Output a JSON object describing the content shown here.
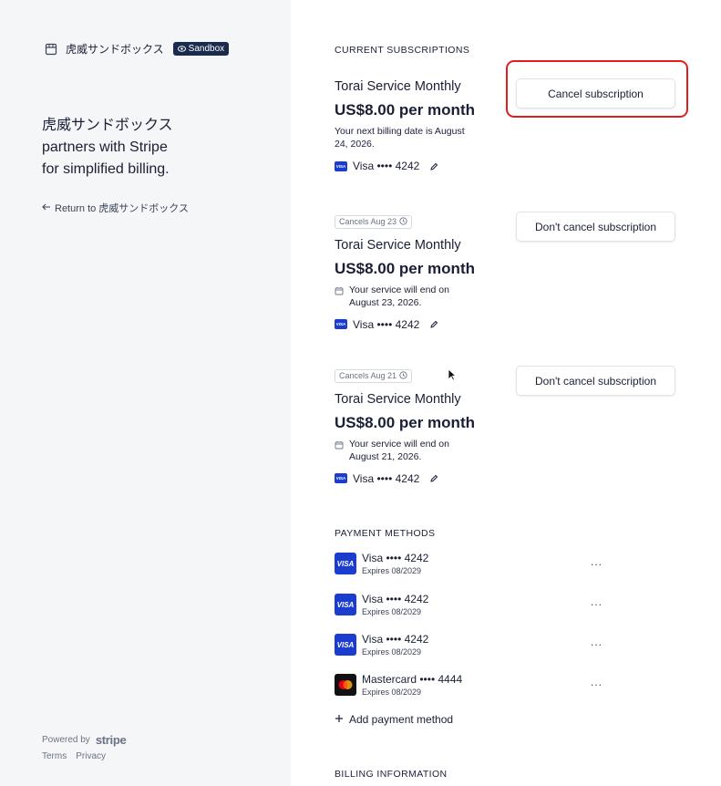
{
  "brand": {
    "name": "虎威サンドボックス",
    "badge": "Sandbox"
  },
  "left": {
    "tagline": "虎威サンドボックス\npartners with Stripe\nfor simplified billing.",
    "return_link": "Return to 虎威サンドボックス",
    "powered_by": "Powered by",
    "powered_brand": "stripe",
    "terms": "Terms",
    "privacy": "Privacy"
  },
  "subscriptions_title": "CURRENT SUBSCRIPTIONS",
  "subscriptions": [
    {
      "badge": "",
      "name": "Torai Service Monthly",
      "price": "US$8.00 per month",
      "note": "Your next billing date is August 24, 2026.",
      "card": "Visa •••• 4242",
      "button": "Cancel subscription"
    },
    {
      "badge": "Cancels Aug 23",
      "name": "Torai Service Monthly",
      "price": "US$8.00 per month",
      "note": "Your service will end on August 23, 2026.",
      "card": "Visa •••• 4242",
      "button": "Don't cancel subscription"
    },
    {
      "badge": "Cancels Aug 21",
      "name": "Torai Service Monthly",
      "price": "US$8.00 per month",
      "note": "Your service will end on August 21, 2026.",
      "card": "Visa •••• 4242",
      "button": "Don't cancel subscription"
    }
  ],
  "payment_methods_title": "PAYMENT METHODS",
  "payment_methods": [
    {
      "brand": "visa",
      "name": "Visa •••• 4242",
      "expires": "Expires 08/2029"
    },
    {
      "brand": "visa",
      "name": "Visa •••• 4242",
      "expires": "Expires 08/2029"
    },
    {
      "brand": "visa",
      "name": "Visa •••• 4242",
      "expires": "Expires 08/2029"
    },
    {
      "brand": "mastercard",
      "name": "Mastercard •••• 4444",
      "expires": "Expires 08/2029"
    }
  ],
  "visa_icon_text": "VISA",
  "more_label": "...",
  "add_payment_method": "Add payment method",
  "billing_info_title": "BILLING INFORMATION",
  "colors": {
    "highlight": "#e21d1d",
    "visa": "#1a3ccf",
    "sandbox_badge": "#1a2b4d",
    "left_panel": "#f5f6f7"
  }
}
